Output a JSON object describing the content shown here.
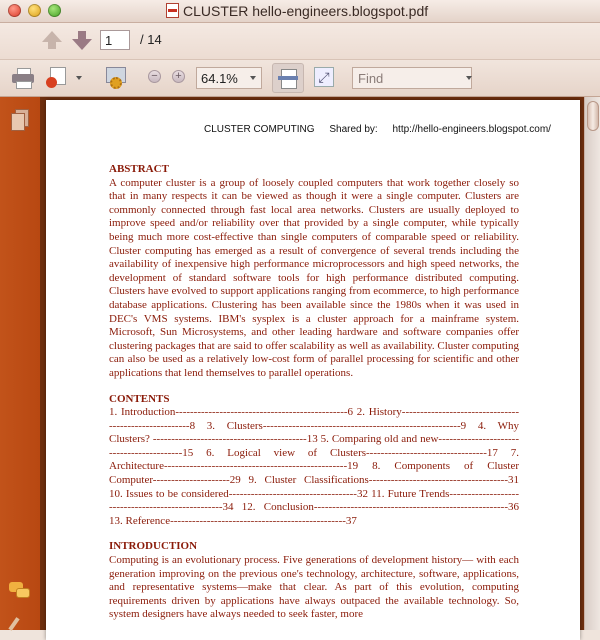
{
  "window": {
    "title": "CLUSTER hello-engineers.blogspot.pdf"
  },
  "toolbar": {
    "page_current": "1",
    "page_total": "/ 14",
    "zoom": "64.1%",
    "find_placeholder": "Find"
  },
  "document": {
    "header": {
      "title": "CLUSTER COMPUTING",
      "shared_by_label": "Shared by:",
      "url": "http://hello-engineers.blogspot.com/"
    },
    "abstract_heading": "ABSTRACT",
    "abstract_text": "A computer cluster is a group of loosely coupled computers that work together closely so that in many respects it can be viewed as though it were a single computer. Clusters are commonly connected through fast local area networks. Clusters are usually deployed to improve speed and/or reliability over that provided by a single computer, while typically being much more cost-effective than single computers of comparable speed or reliability. Cluster computing has emerged as a result of convergence of several trends including the availability of inexpensive high performance microprocessors and high speed networks, the development of standard software tools for high performance distributed computing. Clusters have evolved to support applications ranging from ecommerce, to high performance database applications. Clustering has been available since the 1980s when it was used in DEC's VMS systems. IBM's sysplex is a cluster approach for a mainframe system. Microsoft, Sun Microsystems, and other leading hardware and software companies offer clustering packages that are said to offer scalability as well as availability. Cluster computing can also be used as a relatively low-cost form of parallel processing for scientific and other applications that lend themselves to parallel operations.",
    "contents_heading": "CONTENTS",
    "contents_text": "1. Introduction-----------------------------------------------6 2. History------------------------------------------------------8 3. Clusters------------------------------------------------------9 4. Why Clusters? ------------------------------------------13 5. Comparing old and new------------------------------------------15 6. Logical view of Clusters---------------------------------17 7. Architecture--------------------------------------------------19 8. Components of Cluster Computer---------------------29 9. Cluster Classifications--------------------------------------31 10. Issues to be considered-----------------------------------32 11. Future Trends--------------------------------------------------34 12. Conclusion-----------------------------------------------------36 13. Reference------------------------------------------------37",
    "intro_heading": "INTRODUCTION",
    "intro_text": "Computing is an evolutionary process. Five generations of development history— with each generation improving on the previous one's technology, architecture, software, applications, and representative systems—make that clear. As part of this evolution, computing requirements driven by applications have always outpaced the available technology. So, system designers have always needed to seek faster, more"
  }
}
